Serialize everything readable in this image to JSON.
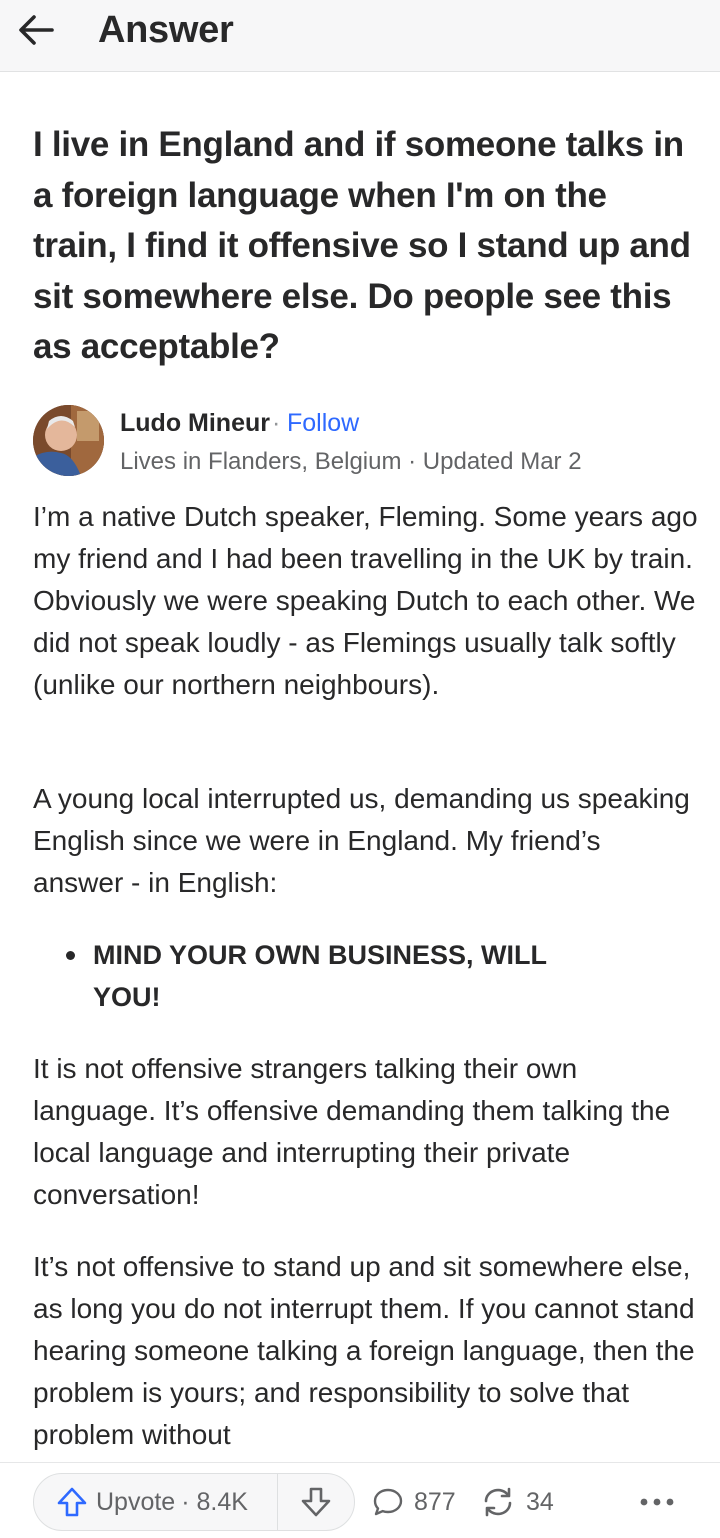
{
  "header": {
    "title": "Answer",
    "back_icon": "arrow-left-icon"
  },
  "question": {
    "text": "I live in England and if someone talks in a foreign language when I'm on the train, I find it offensive so I stand up and sit somewhere else. Do people see this as acceptable?"
  },
  "author": {
    "name": "Ludo Mineur",
    "separator": "·",
    "follow_label": "Follow",
    "credential": "Lives in Flanders, Belgium · Updated Mar 2"
  },
  "answer": {
    "p1": "I’m a native Dutch speaker, Fleming. Some years ago my friend and I had been travelling in the UK by train. Obviously we were speaking Dutch to each other. We did not speak loudly - as Flemings usually talk softly (unlike our northern neighbours).",
    "p2": "A young local interrupted us, demanding us speaking English since we were in England. My friend’s answer - in English:",
    "bullet": "MIND YOUR OWN BUSINESS, WILL YOU!",
    "p3": "It is not offensive strangers talking their own language. It’s offensive demanding them talking the local language and interrupting their private conversation!",
    "p4": "It’s not offensive to stand up and sit somewhere else, as long you do not interrupt them. If you cannot stand hearing someone talking a foreign language, then the problem is yours; and responsibility to solve that problem without"
  },
  "actions": {
    "upvote_label": "Upvote",
    "upvote_count": "· 8.4K",
    "comments_count": "877",
    "shares_count": "34",
    "accent_color": "#2e69ff"
  }
}
